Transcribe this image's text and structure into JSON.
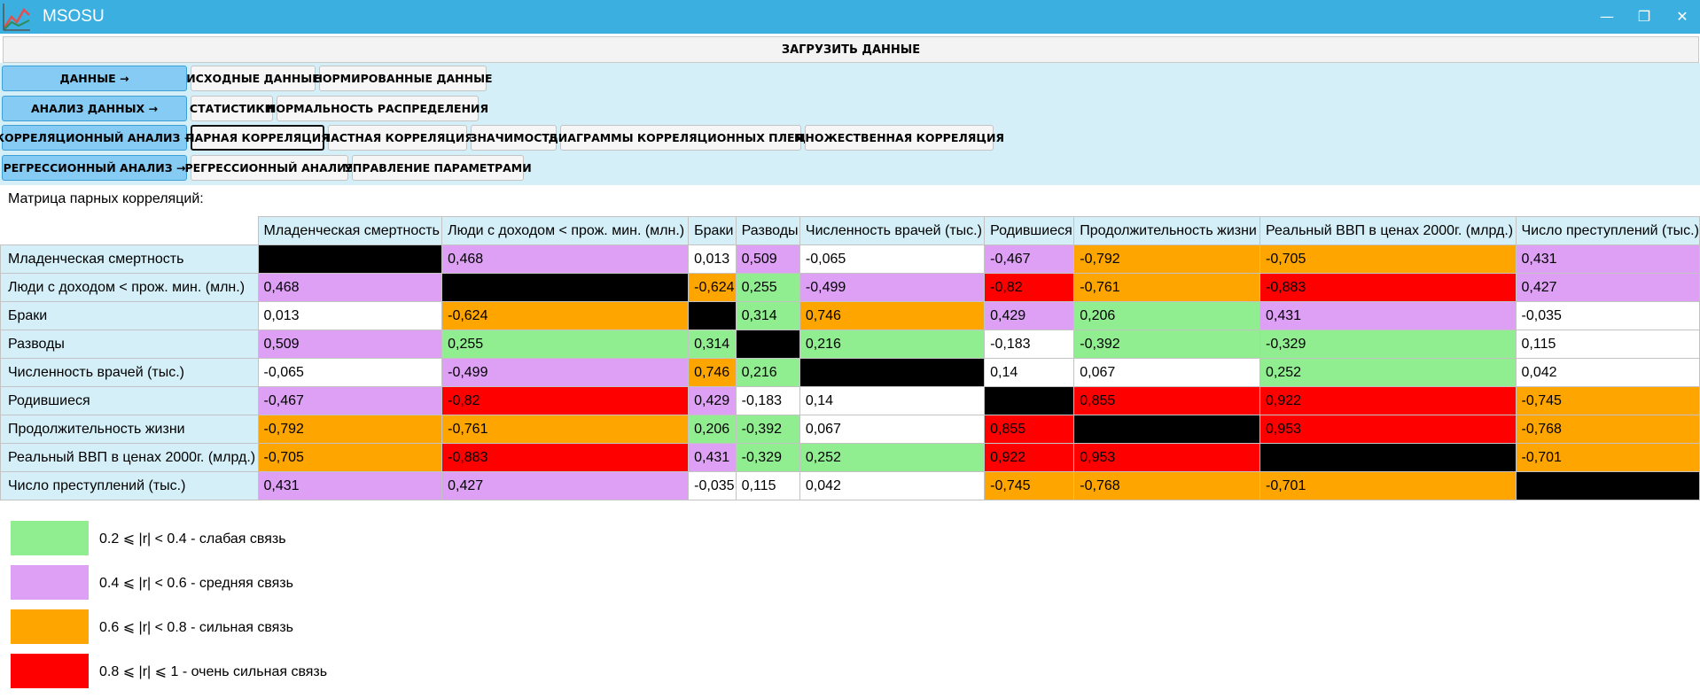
{
  "window": {
    "title": "MSOSU",
    "minimize_glyph": "—",
    "restore_glyph": "❐",
    "close_glyph": "✕"
  },
  "load_button": "ЗАГРУЗИТЬ ДАННЫЕ",
  "nav": {
    "rows": [
      {
        "category": "ДАННЫЕ →",
        "items": [
          "ИСХОДНЫЕ ДАННЫЕ",
          "НОРМИРОВАННЫЕ ДАННЫЕ"
        ]
      },
      {
        "category": "АНАЛИЗ ДАННЫХ →",
        "items": [
          "СТАТИСТИКИ",
          "НОРМАЛЬНОСТЬ РАСПРЕДЕЛЕНИЯ"
        ]
      },
      {
        "category": "КОРРЕЛЯЦИОННЫЙ АНАЛИЗ →",
        "items": [
          "ПАРНАЯ КОРРЕЛЯЦИЯ",
          "ЧАСТНАЯ КОРРЕЛЯЦИЯ",
          "ЗНАЧИМОСТЬ",
          "ДИАГРАММЫ КОРРЕЛЯЦИОННЫХ ПЛЕЯД",
          "МНОЖЕСТВЕННАЯ КОРРЕЛЯЦИЯ"
        ]
      },
      {
        "category": "РЕГРЕССИОННЫЙ АНАЛИЗ →",
        "items": [
          "РЕГРЕССИОННЫЙ АНАЛИЗ",
          "УПРАВЛЕНИЕ ПАРАМЕТРАМИ"
        ]
      }
    ],
    "active_item": "ПАРНАЯ КОРРЕЛЯЦИЯ"
  },
  "matrix_label": "Матрица парных корреляций:",
  "matrix": {
    "columns": [
      "Младенческая смертность",
      "Люди с доходом < прож. мин. (млн.)",
      "Браки",
      "Разводы",
      "Численность врачей (тыс.)",
      "Родившиеся",
      "Продолжительность жизни",
      "Реальный ВВП в ценах 2000г. (млрд.)",
      "Число преступлений (тыс.)"
    ],
    "rows": [
      {
        "label": "Младенческая смертность",
        "cells": [
          {
            "v": "",
            "c": "black"
          },
          {
            "v": "0,468",
            "c": "violet"
          },
          {
            "v": "0,013",
            "c": "white"
          },
          {
            "v": "0,509",
            "c": "violet"
          },
          {
            "v": "-0,065",
            "c": "white"
          },
          {
            "v": "-0,467",
            "c": "violet"
          },
          {
            "v": "-0,792",
            "c": "orange"
          },
          {
            "v": "-0,705",
            "c": "orange"
          },
          {
            "v": "0,431",
            "c": "violet"
          }
        ]
      },
      {
        "label": "Люди с доходом < прож. мин. (млн.)",
        "cells": [
          {
            "v": "0,468",
            "c": "violet"
          },
          {
            "v": "",
            "c": "black"
          },
          {
            "v": "-0,624",
            "c": "orange"
          },
          {
            "v": "0,255",
            "c": "green"
          },
          {
            "v": "-0,499",
            "c": "violet"
          },
          {
            "v": "-0,82",
            "c": "red"
          },
          {
            "v": "-0,761",
            "c": "orange"
          },
          {
            "v": "-0,883",
            "c": "red"
          },
          {
            "v": "0,427",
            "c": "violet"
          }
        ]
      },
      {
        "label": "Браки",
        "cells": [
          {
            "v": "0,013",
            "c": "white"
          },
          {
            "v": "-0,624",
            "c": "orange"
          },
          {
            "v": "",
            "c": "black"
          },
          {
            "v": "0,314",
            "c": "green"
          },
          {
            "v": "0,746",
            "c": "orange"
          },
          {
            "v": "0,429",
            "c": "violet"
          },
          {
            "v": "0,206",
            "c": "green"
          },
          {
            "v": "0,431",
            "c": "violet"
          },
          {
            "v": "-0,035",
            "c": "white"
          }
        ]
      },
      {
        "label": "Разводы",
        "cells": [
          {
            "v": "0,509",
            "c": "violet"
          },
          {
            "v": "0,255",
            "c": "green"
          },
          {
            "v": "0,314",
            "c": "green"
          },
          {
            "v": "",
            "c": "black"
          },
          {
            "v": "0,216",
            "c": "green"
          },
          {
            "v": "-0,183",
            "c": "white"
          },
          {
            "v": "-0,392",
            "c": "green"
          },
          {
            "v": "-0,329",
            "c": "green"
          },
          {
            "v": "0,115",
            "c": "white"
          }
        ]
      },
      {
        "label": "Численность врачей (тыс.)",
        "cells": [
          {
            "v": "-0,065",
            "c": "white"
          },
          {
            "v": "-0,499",
            "c": "violet"
          },
          {
            "v": "0,746",
            "c": "orange"
          },
          {
            "v": "0,216",
            "c": "green"
          },
          {
            "v": "",
            "c": "black"
          },
          {
            "v": "0,14",
            "c": "white"
          },
          {
            "v": "0,067",
            "c": "white"
          },
          {
            "v": "0,252",
            "c": "green"
          },
          {
            "v": "0,042",
            "c": "white"
          }
        ]
      },
      {
        "label": "Родившиеся",
        "cells": [
          {
            "v": "-0,467",
            "c": "violet"
          },
          {
            "v": "-0,82",
            "c": "red"
          },
          {
            "v": "0,429",
            "c": "violet"
          },
          {
            "v": "-0,183",
            "c": "white"
          },
          {
            "v": "0,14",
            "c": "white"
          },
          {
            "v": "",
            "c": "black"
          },
          {
            "v": "0,855",
            "c": "red"
          },
          {
            "v": "0,922",
            "c": "red"
          },
          {
            "v": "-0,745",
            "c": "orange"
          }
        ]
      },
      {
        "label": "Продолжительность жизни",
        "cells": [
          {
            "v": "-0,792",
            "c": "orange"
          },
          {
            "v": "-0,761",
            "c": "orange"
          },
          {
            "v": "0,206",
            "c": "green"
          },
          {
            "v": "-0,392",
            "c": "green"
          },
          {
            "v": "0,067",
            "c": "white"
          },
          {
            "v": "0,855",
            "c": "red"
          },
          {
            "v": "",
            "c": "black"
          },
          {
            "v": "0,953",
            "c": "red"
          },
          {
            "v": "-0,768",
            "c": "orange"
          }
        ]
      },
      {
        "label": "Реальный ВВП в ценах 2000г. (млрд.)",
        "cells": [
          {
            "v": "-0,705",
            "c": "orange"
          },
          {
            "v": "-0,883",
            "c": "red"
          },
          {
            "v": "0,431",
            "c": "violet"
          },
          {
            "v": "-0,329",
            "c": "green"
          },
          {
            "v": "0,252",
            "c": "green"
          },
          {
            "v": "0,922",
            "c": "red"
          },
          {
            "v": "0,953",
            "c": "red"
          },
          {
            "v": "",
            "c": "black"
          },
          {
            "v": "-0,701",
            "c": "orange"
          }
        ]
      },
      {
        "label": "Число преступлений (тыс.)",
        "cells": [
          {
            "v": "0,431",
            "c": "violet"
          },
          {
            "v": "0,427",
            "c": "violet"
          },
          {
            "v": "-0,035",
            "c": "white"
          },
          {
            "v": "0,115",
            "c": "white"
          },
          {
            "v": "0,042",
            "c": "white"
          },
          {
            "v": "-0,745",
            "c": "orange"
          },
          {
            "v": "-0,768",
            "c": "orange"
          },
          {
            "v": "-0,701",
            "c": "orange"
          },
          {
            "v": "",
            "c": "black"
          }
        ]
      }
    ]
  },
  "legend": [
    {
      "color": "#90ee90",
      "text": "0.2 ⩽ |r| < 0.4 - слабая связь"
    },
    {
      "color": "#dda0f5",
      "text": "0.4 ⩽ |r| < 0.6 - средняя связь"
    },
    {
      "color": "#ffa500",
      "text": "0.6 ⩽ |r| < 0.8 - сильная связь"
    },
    {
      "color": "#ff0000",
      "text": "0.8 ⩽ |r| ⩽ 1 - очень сильная связь"
    }
  ],
  "colors": {
    "titlebar": "#3bb0e0",
    "panel": "#d5eff8",
    "category_button": "#86cbf3"
  }
}
